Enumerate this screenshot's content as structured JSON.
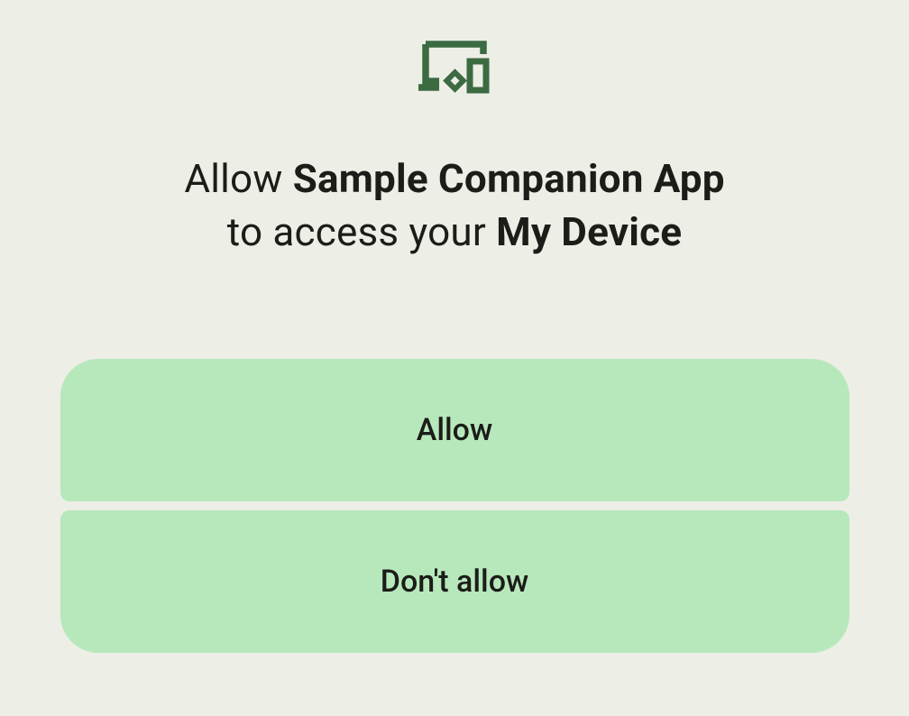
{
  "title": {
    "prefix": "Allow ",
    "app": "Sample Companion App",
    "mid": "to access your ",
    "device": "My Device"
  },
  "buttons": {
    "allow": "Allow",
    "deny": "Don't allow"
  },
  "colors": {
    "accent": "#3c6b42",
    "button_bg": "#b7e8bb",
    "page_bg": "#edeee6"
  }
}
